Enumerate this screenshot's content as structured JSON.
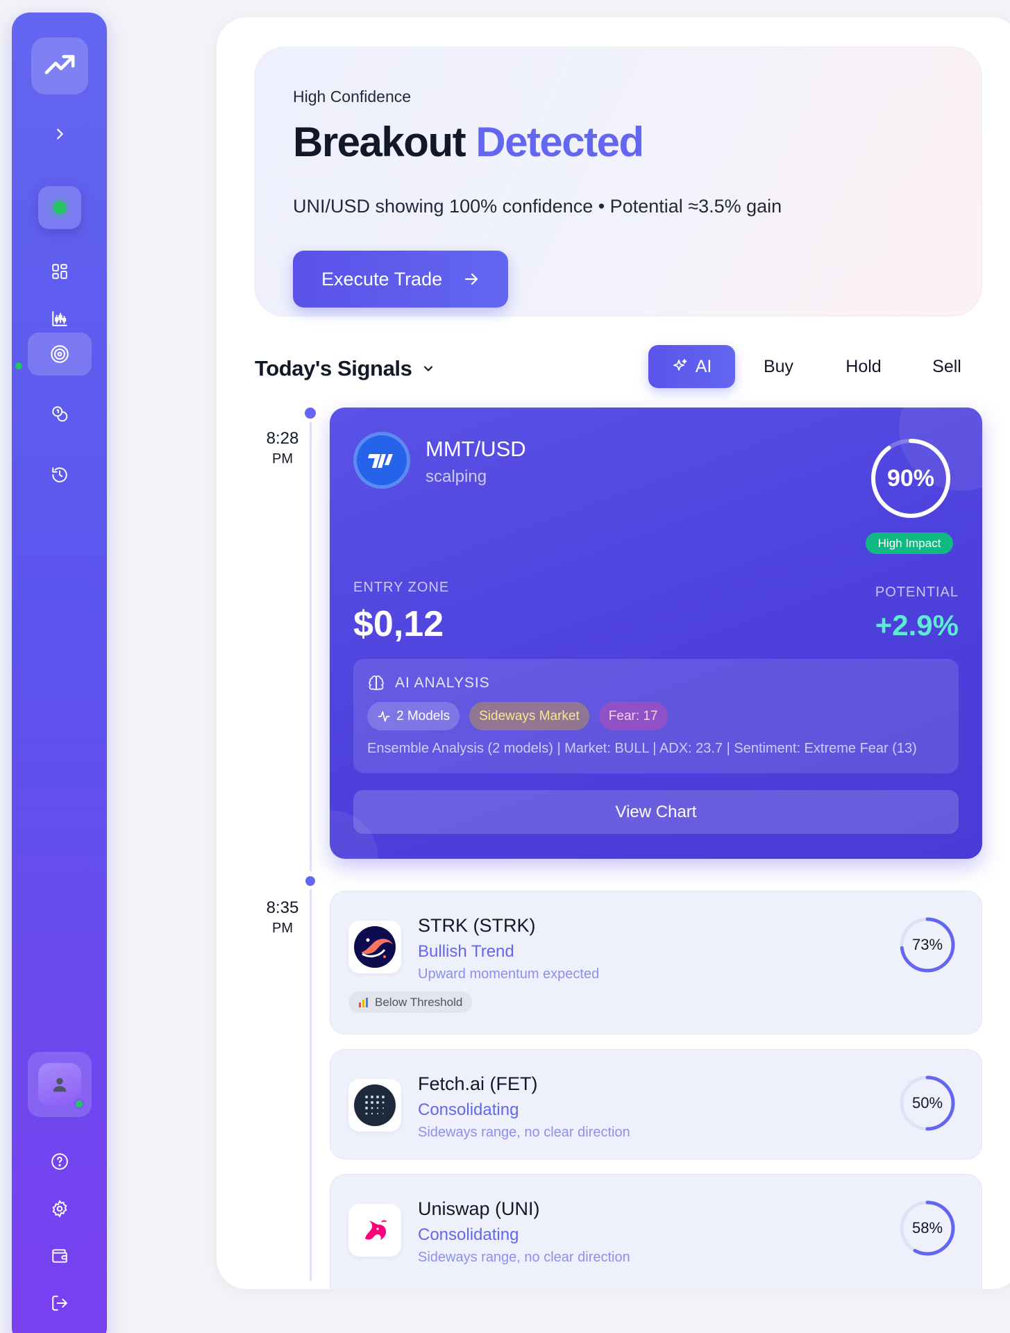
{
  "sidebar": {
    "icons": [
      "trending-up-icon",
      "chevron-right-icon",
      "status-dot",
      "dashboard-icon",
      "chart-icon",
      "target-icon",
      "coins-icon",
      "history-icon",
      "user-icon",
      "help-icon",
      "settings-icon",
      "wallet-icon",
      "logout-icon"
    ]
  },
  "hero": {
    "eyebrow": "High Confidence",
    "title_main": "Breakout",
    "title_accent": "Detected",
    "subtitle": "UNI/USD showing 100% confidence • Potential ≈3.5% gain",
    "button_label": "Execute Trade"
  },
  "signals": {
    "title": "Today's Signals",
    "filters": {
      "ai": "AI",
      "buy": "Buy",
      "hold": "Hold",
      "sell": "Sell"
    }
  },
  "timeline": [
    {
      "hour": "8:28",
      "ampm": "PM"
    },
    {
      "hour": "8:35",
      "ampm": "PM"
    }
  ],
  "featured": {
    "pair": "MMT/USD",
    "strategy": "scalping",
    "confidence_label": "90%",
    "confidence": 0.9,
    "impact": "High Impact",
    "entry_label": "ENTRY ZONE",
    "entry_value": "$0,12",
    "potential_label": "POTENTIAL",
    "potential_value": "+2.9%",
    "analysis": {
      "heading": "AI ANALYSIS",
      "chip_models": "2 Models",
      "chip_market": "Sideways Market",
      "chip_fear": "Fear: 17",
      "detail": "Ensemble Analysis (2 models) | Market: BULL | ADX: 23.7 | Sentiment: Extreme Fear (13)"
    },
    "view_chart": "View Chart"
  },
  "signal_list": [
    {
      "name": "STRK (STRK)",
      "trend": "Bullish Trend",
      "desc": "Upward momentum expected",
      "confidence_label": "73%",
      "confidence": 0.73,
      "badge": "Below Threshold"
    },
    {
      "name": "Fetch.ai (FET)",
      "trend": "Consolidating",
      "desc": "Sideways range, no clear direction",
      "confidence_label": "50%",
      "confidence": 0.5
    },
    {
      "name": "Uniswap (UNI)",
      "trend": "Consolidating",
      "desc": "Sideways range, no clear direction",
      "confidence_label": "58%",
      "confidence": 0.58
    }
  ],
  "colors": {
    "accent": "#6366f1",
    "positive": "#5eead4",
    "impact": "#10b981",
    "online": "#22c55e"
  }
}
